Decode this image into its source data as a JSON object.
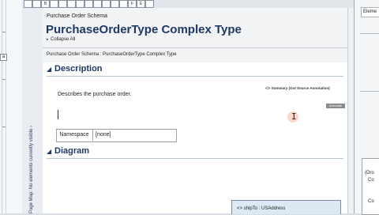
{
  "sidebar": {
    "vertical_label": "Page Map: No elements currently visible ›",
    "box_label": "a"
  },
  "toolbar": {
    "buttons": [
      "",
      "",
      "B",
      "",
      "",
      "",
      "",
      "",
      "",
      "",
      "",
      "",
      "F",
      "E",
      ""
    ]
  },
  "document": {
    "schema_label": "Purchase Order Schema",
    "title": "PurchaseOrderType Complex Type",
    "collapse_all": "Collapse All",
    "breadcrumb": "Purchase Order Schema : PurchaseOrderType Complex Type",
    "description_heading": "Description",
    "summary_links": "</> Summary (Got Source Annotation)",
    "description_text": "Describes the purchase order.",
    "gray_tag": "Annotate",
    "namespace_label": "Namespace",
    "namespace_value": "[none]",
    "diagram_heading": "Diagram",
    "diagram_box_text": "<>  shipTo : USAddress"
  },
  "right_panel": {
    "header": "Eleme",
    "block_line1": "(Dro",
    "block_line2": "Co",
    "block_line3": "Co"
  }
}
